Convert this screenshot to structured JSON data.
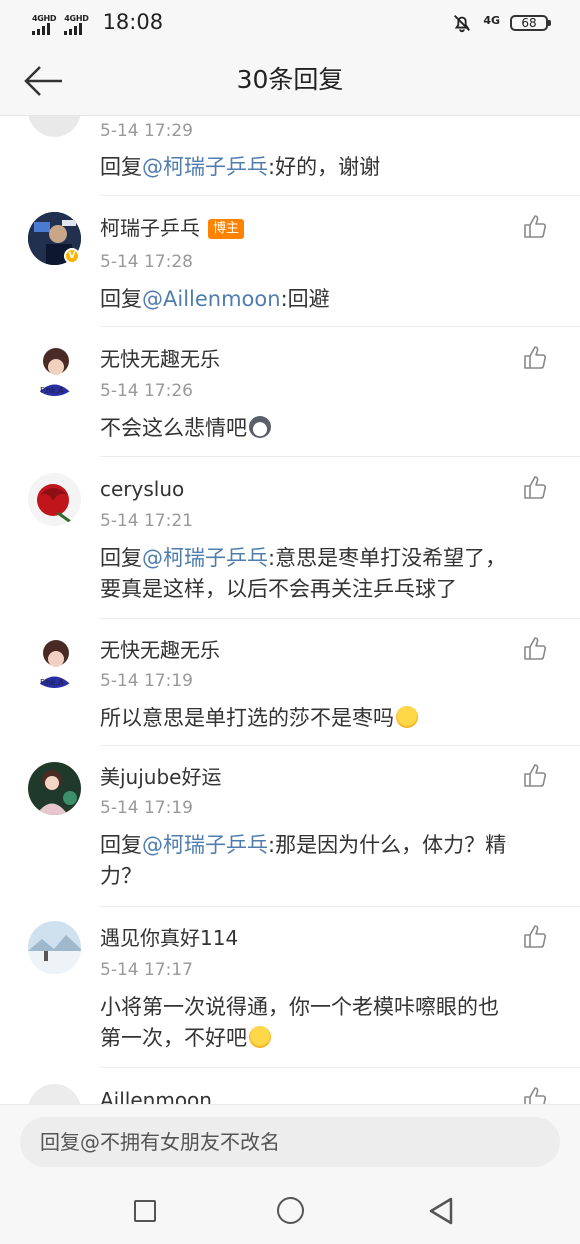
{
  "status_bar": {
    "sim1": "4GHD",
    "sim2": "4GHD",
    "time": "18:08",
    "network": "4G",
    "battery": "68"
  },
  "header": {
    "title": "30条回复",
    "back_icon": "arrow-left-icon"
  },
  "comments": [
    {
      "name": "",
      "time": "5-14 17:29",
      "prefix": "回复",
      "mention": "@柯瑞子乒乓",
      "text": ":好的，谢谢"
    },
    {
      "name": "柯瑞子乒乓",
      "badge": "博主",
      "verified": true,
      "time": "5-14 17:28",
      "prefix": "回复",
      "mention": "@Aillenmoon",
      "text": ":回避"
    },
    {
      "name": "无快无趣无乐",
      "time": "5-14 17:26",
      "text": "不会这么悲情吧",
      "emoji": "dog-face-emoji"
    },
    {
      "name": "cerysluo",
      "time": "5-14 17:21",
      "prefix": "回复",
      "mention": "@柯瑞子乒乓",
      "text": ":意思是枣单打没希望了，",
      "text2": "要真是这样，以后不会再关注乒乓球了"
    },
    {
      "name": "无快无趣无乐",
      "time": "5-14 17:19",
      "text": "所以意思是单打选的莎不是枣吗",
      "emoji": "crying-face-emoji"
    },
    {
      "name": "美jujube好运",
      "time": "5-14 17:19",
      "prefix": "回复",
      "mention": "@柯瑞子乒乓",
      "text": ":那是因为什么，体力？精",
      "text2": "力？"
    },
    {
      "name": "遇见你真好114",
      "time": "5-14 17:17",
      "text": "小将第一次说得通，你一个老模咔嚓眼的也",
      "text2": "第一次，不好吧",
      "emoji": "grinning-face-emoji"
    },
    {
      "name": "Aillenmoon",
      "time": "",
      "text": ""
    }
  ],
  "reply_input": {
    "placeholder": "回复@不拥有女朋友不改名"
  },
  "colors": {
    "mention": "#507daf",
    "badge": "#ff8200",
    "verified": "#f7b500"
  }
}
